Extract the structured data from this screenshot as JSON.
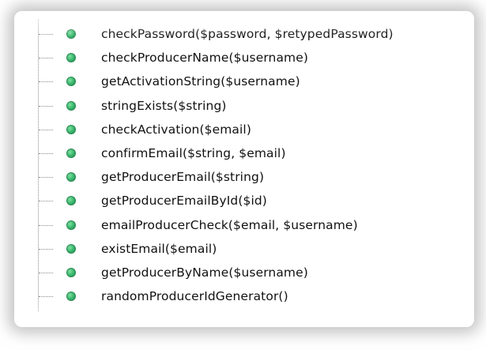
{
  "outline": {
    "items": [
      {
        "label": "checkPassword($password, $retypedPassword)"
      },
      {
        "label": "checkProducerName($username)"
      },
      {
        "label": "getActivationString($username)"
      },
      {
        "label": "stringExists($string)"
      },
      {
        "label": "checkActivation($email)"
      },
      {
        "label": "confirmEmail($string, $email)"
      },
      {
        "label": "getProducerEmail($string)"
      },
      {
        "label": "getProducerEmailById($id)"
      },
      {
        "label": "emailProducerCheck($email, $username)"
      },
      {
        "label": "existEmail($email)"
      },
      {
        "label": "getProducerByName($username)"
      },
      {
        "label": "randomProducerIdGenerator()"
      }
    ],
    "icon": "public-method-icon",
    "icon_color": "#36b36a"
  }
}
